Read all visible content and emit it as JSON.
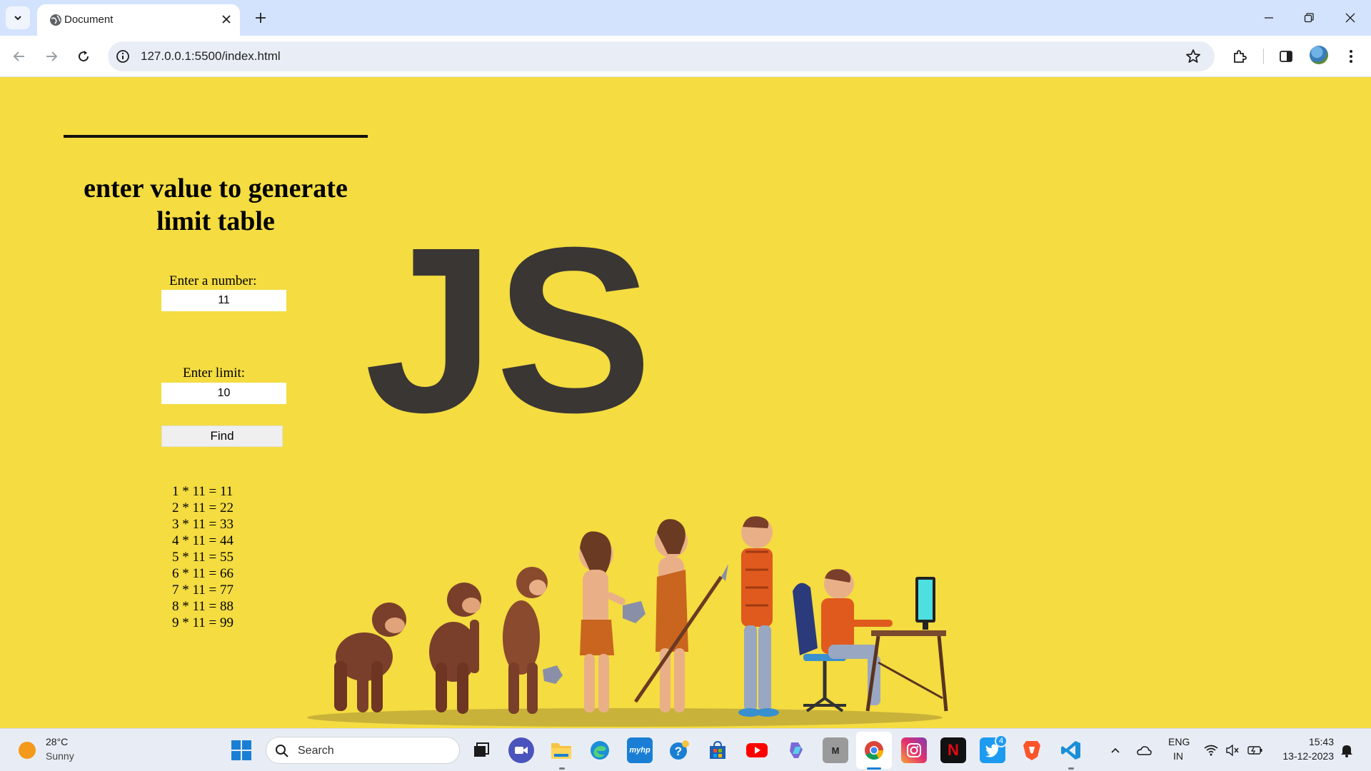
{
  "browser": {
    "tab_title": "Document",
    "url": "127.0.0.1:5500/index.html"
  },
  "page": {
    "heading": "enter value to generate limit table",
    "number_label": "Enter a number:",
    "number_value": "11",
    "limit_label": "Enter limit:",
    "limit_value": "10",
    "find_label": "Find",
    "results": [
      "1 * 11 = 11",
      "2 * 11 = 22",
      "3 * 11 = 33",
      "4 * 11 = 44",
      "5 * 11 = 55",
      "6 * 11 = 66",
      "7 * 11 = 77",
      "8 * 11 = 88",
      "9 * 11 = 99"
    ],
    "logo_text": "JS",
    "background_color": "#f4dc41"
  },
  "taskbar": {
    "weather_temp": "28°C",
    "weather_condition": "Sunny",
    "search_placeholder": "Search",
    "lang_line1": "ENG",
    "lang_line2": "IN",
    "time": "15:43",
    "date": "13-12-2023",
    "twitter_badge": "4",
    "apps": [
      "task-view",
      "meet",
      "file-explorer",
      "edge",
      "myhp",
      "help",
      "store",
      "youtube",
      "copilot",
      "app-m",
      "chrome",
      "instagram",
      "netflix",
      "twitter",
      "brave",
      "vscode"
    ]
  }
}
